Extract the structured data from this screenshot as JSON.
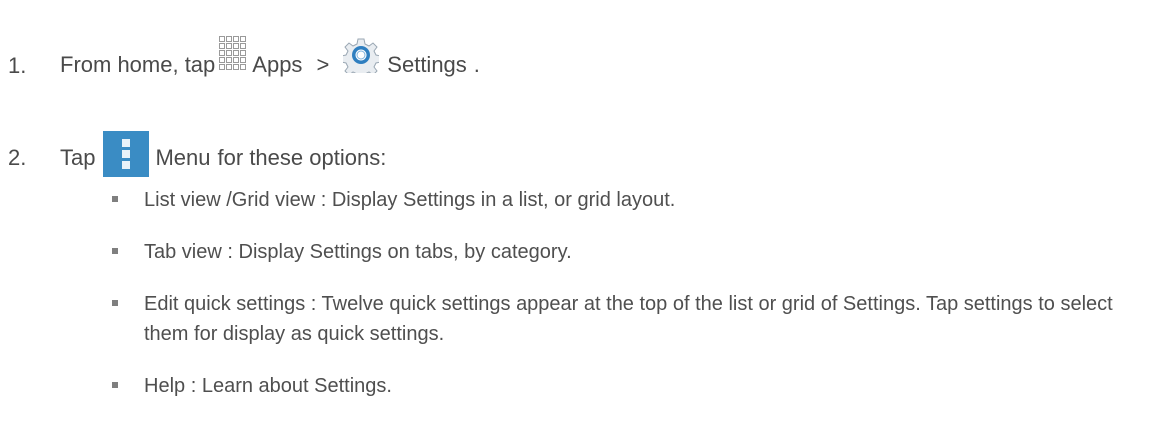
{
  "steps": [
    {
      "number": "1.",
      "text_before": "From home, tap",
      "apps_label": "Apps",
      "separator": ">",
      "settings_label": "Settings",
      "end": "."
    },
    {
      "number": "2.",
      "text_before": "Tap",
      "menu_label": "Menu",
      "text_after": "for these options:"
    }
  ],
  "options": [
    {
      "term": "List view /Grid view",
      "sep": ":",
      "desc": "Display Settings in a list, or grid layout."
    },
    {
      "term": "Tab view",
      "sep": ":",
      "desc": "Display Settings on tabs, by category."
    },
    {
      "term": "Edit quick settings",
      "sep": ":",
      "desc": "Twelve quick settings appear at the top of the list or grid of Settings. Tap settings to select them for display as quick settings."
    },
    {
      "term": "Help",
      "sep": ":",
      "desc": "Learn about Settings."
    }
  ],
  "icons": {
    "apps": "apps-grid-icon",
    "settings": "gear-icon",
    "menu": "menu-overflow-icon"
  },
  "colors": {
    "text": "#4a4a4a",
    "menu_icon_bg": "#3a8cc4",
    "gear_blue": "#2f7fc0"
  }
}
